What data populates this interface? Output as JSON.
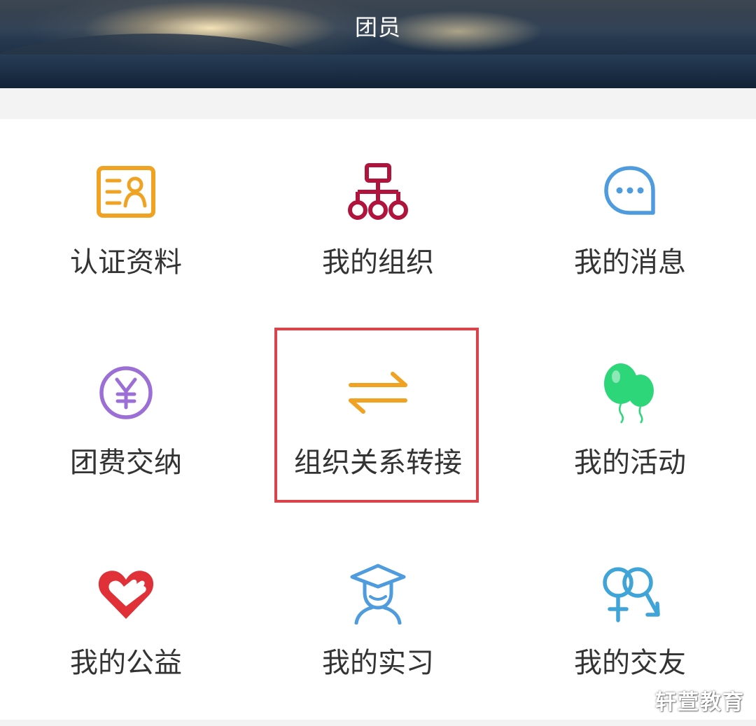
{
  "header": {
    "title": "团员"
  },
  "menu": [
    {
      "label": "认证资料",
      "icon": "id-card-icon",
      "color": "#F0A322"
    },
    {
      "label": "我的组织",
      "icon": "org-chart-icon",
      "color": "#B0133C"
    },
    {
      "label": "我的消息",
      "icon": "chat-bubble-icon",
      "color": "#4E9BDE"
    },
    {
      "label": "团费交纳",
      "icon": "yuan-coin-icon",
      "color": "#9C6FD6"
    },
    {
      "label": "组织关系转接",
      "icon": "transfer-arrows-icon",
      "color": "#F0A322"
    },
    {
      "label": "我的活动",
      "icon": "balloons-icon",
      "color": "#2ED67A"
    },
    {
      "label": "我的公益",
      "icon": "heart-hand-icon",
      "color": "#E03038"
    },
    {
      "label": "我的实习",
      "icon": "graduate-icon",
      "color": "#4E9BDE"
    },
    {
      "label": "我的交友",
      "icon": "gender-symbols-icon",
      "color": "#3FA4D8"
    }
  ],
  "highlight_color": "#D9434B",
  "watermark": "轩萱教育"
}
